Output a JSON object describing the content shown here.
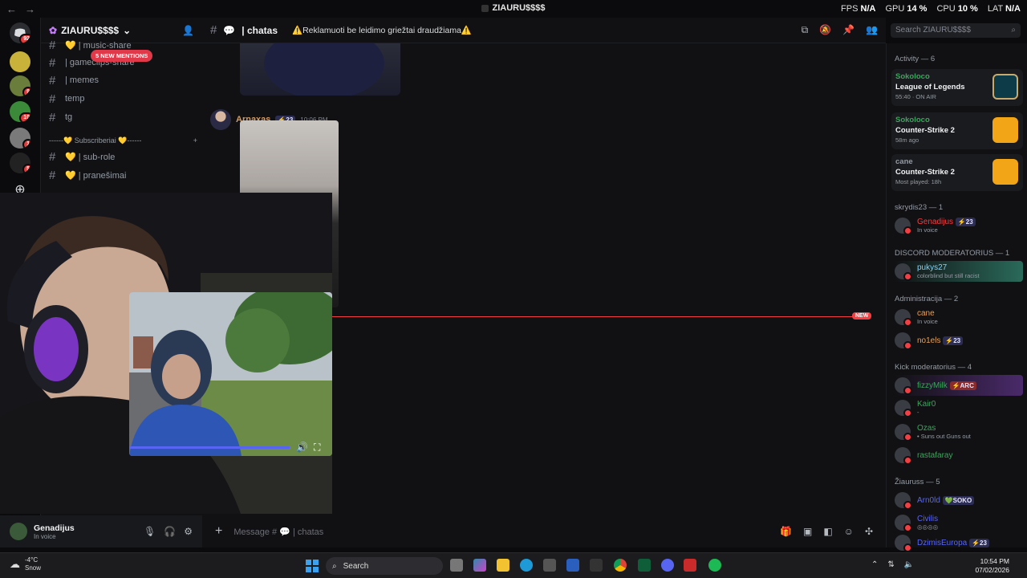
{
  "window": {
    "title": "ZIAURU$$$$",
    "stats": {
      "fps_label": "FPS",
      "fps": "N/A",
      "gpu_label": "GPU",
      "gpu": "14 %",
      "cpu_label": "CPU",
      "cpu": "10 %",
      "lat_label": "LAT",
      "lat": "N/A"
    }
  },
  "servers": [
    {
      "badge": "92"
    },
    {
      "badge": ""
    },
    {
      "badge": "9"
    },
    {
      "badge": "10"
    },
    {
      "badge": "1"
    },
    {
      "badge": "5"
    }
  ],
  "guild": {
    "name": "ZIAURU$$$$"
  },
  "channels": {
    "mentions": "5 NEW MENTIONS",
    "items": [
      {
        "name": "💛 | music-share"
      },
      {
        "name": "| gameclips-share"
      },
      {
        "name": "| memes"
      },
      {
        "name": "temp"
      },
      {
        "name": "tg"
      },
      {
        "name": "💛 | sub-role"
      },
      {
        "name": "💛 | pranešimai"
      }
    ],
    "category": "------💛 Subscriberiai 💛------"
  },
  "chat_header": {
    "channel": "| chatas",
    "topic": "⚠️Reklamuoti be leidimo griežtai draudžiama⚠️"
  },
  "search": {
    "placeholder": "Search ZIAURU$$$$"
  },
  "message": {
    "author": "Arnaxas",
    "tag": "⚡23",
    "time": "10:06 PM"
  },
  "new_label": "NEW",
  "composer": {
    "placeholder": "Message # 💬 | chatas"
  },
  "user": {
    "name": "Genadijus",
    "status": "In voice"
  },
  "activity": {
    "title": "Activity — 6",
    "cards": [
      {
        "who": "Sokoloco",
        "game": "League of Legends",
        "meta": "55:40 · ON AIR",
        "color": "#c8aa6e"
      },
      {
        "who": "Sokoloco",
        "game": "Counter-Strike 2",
        "meta": "58m ago",
        "color": "#f2a516"
      },
      {
        "who": "cane",
        "game": "Counter-Strike 2",
        "meta": "Most played: 18h",
        "color": "#f2a516"
      }
    ]
  },
  "groups": [
    {
      "title": "skrydis23 — 1",
      "members": [
        {
          "name": "Genadijus",
          "tag": "⚡23",
          "sub": "In voice",
          "color": "#f23f43"
        }
      ]
    },
    {
      "title": "DISCORD MODERATORIUS — 1",
      "members": [
        {
          "name": "pukys27",
          "tag": "",
          "sub": "colorblind but still racist",
          "color": "#7dd3fc"
        }
      ]
    },
    {
      "title": "Administracija — 2",
      "members": [
        {
          "name": "cane",
          "tag": "",
          "sub": "In voice",
          "color": "#e6a05a"
        },
        {
          "name": "no1els",
          "tag": "⚡23",
          "sub": "",
          "color": "#e6a05a"
        }
      ]
    },
    {
      "title": "Kick moderatorius — 4",
      "members": [
        {
          "name": "fizzyMilk",
          "tag": "⚡ARC",
          "sub": "",
          "color": "#3ba55c"
        },
        {
          "name": "Kair0",
          "tag": "",
          "sub": "-",
          "color": "#3ba55c"
        },
        {
          "name": "Ozas",
          "tag": "",
          "sub": "• Suns out Guns out",
          "color": "#3ba55c"
        },
        {
          "name": "rastafaray",
          "tag": "",
          "sub": "",
          "color": "#3ba55c"
        }
      ]
    },
    {
      "title": "Žiauruss — 5",
      "members": [
        {
          "name": "Arn0ld",
          "tag": "💚SOKO",
          "sub": "",
          "color": "#5865f2"
        },
        {
          "name": "Civilis",
          "tag": "",
          "sub": "◎◎◎◎",
          "color": "#5865f2"
        },
        {
          "name": "DzimisEuropa",
          "tag": "⚡23",
          "sub": "",
          "color": "#5865f2"
        }
      ]
    }
  ],
  "taskbar": {
    "weather_temp": "-4°C",
    "weather_desc": "Snow",
    "search": "Search",
    "time": "10:54 PM",
    "date": "07/02/2026"
  }
}
